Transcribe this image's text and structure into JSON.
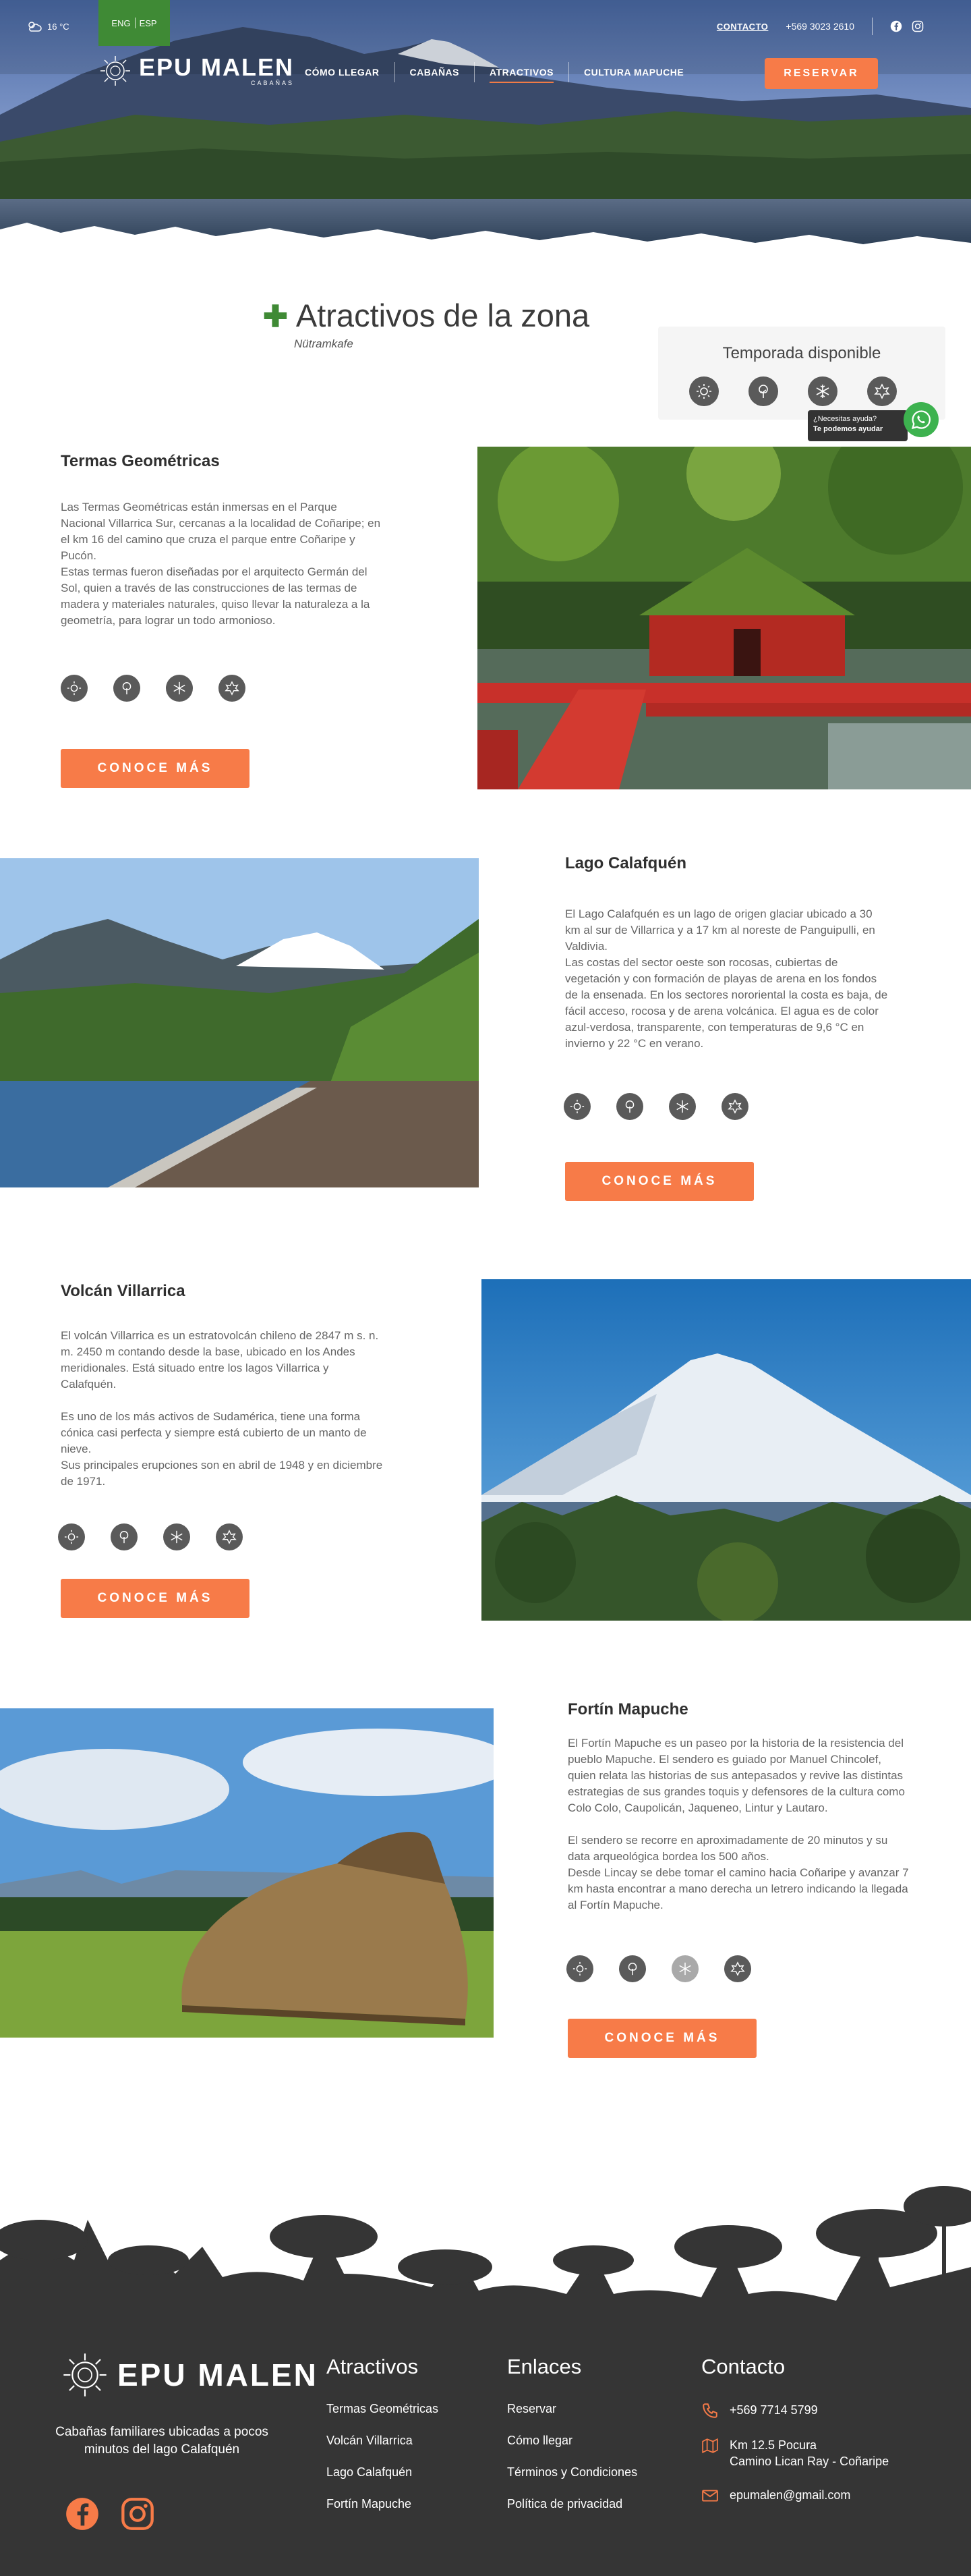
{
  "topbar": {
    "weather": "16 °C",
    "lang": [
      "ENG",
      "ESP"
    ],
    "contact_label": "CONTACTO",
    "phone": "+569 3023 2610"
  },
  "brand": {
    "name": "EPU MALEN",
    "sub": "CABAÑAS"
  },
  "nav": {
    "items": [
      "CÓMO LLEGAR",
      "CABAÑAS",
      "ATRACTIVOS",
      "CULTURA MAPUCHE"
    ],
    "active": "ATRACTIVOS",
    "reserve": "RESERVAR"
  },
  "page": {
    "title_highlight": "Atractivos",
    "title_rest": "de la zona",
    "subtitle": "Nütramkafe"
  },
  "season": {
    "label": "Temporada disponible",
    "icons": [
      "sun-icon",
      "spring-tree-icon",
      "snowflake-icon",
      "autumn-leaf-icon"
    ]
  },
  "help": {
    "line1": "¿Necesitas ayuda?",
    "line2": "Te podemos ayudar"
  },
  "attractions": [
    {
      "title": "Termas Geométricas",
      "paragraphs": [
        "Las Termas Geométricas están inmersas en el Parque Nacional Villarrica Sur, cercanas a la localidad de Coñaripe; en el km 16 del camino que cruza el parque entre Coñaripe y Pucón.",
        "Estas termas fueron diseñadas por el arquitecto Germán del Sol, quien a través de las construcciones de las termas de madera y materiales naturales, quiso llevar la naturaleza a la geometría, para lograr un todo armonioso."
      ],
      "button": "CONOCE MÁS"
    },
    {
      "title": "Lago Calafquén",
      "paragraphs": [
        "El Lago Calafquén es un lago de origen glaciar ubicado a 30 km al sur de Villarrica y a 17 km al noreste de Panguipulli, en Valdivia.",
        "Las costas del sector oeste son rocosas, cubiertas de vegetación y con formación de playas de arena en los fondos de la ensenada. En los sectores nororiental la costa es baja, de fácil acceso, rocosa y de arena volcánica. El agua es de color azul-verdosa, transparente, con temperaturas de 9,6 °C en invierno y 22 °C en verano."
      ],
      "button": "CONOCE MÁS"
    },
    {
      "title": "Volcán Villarrica",
      "paragraphs": [
        "El volcán Villarrica es un estratovolcán chileno de 2847 m s. n. m. 2450 m contando desde la base, ubicado en los Andes meridionales. Está situado entre los lagos Villarrica y Calafquén.",
        "Es uno de los más activos de Sudamérica, tiene una forma cónica casi perfecta y siempre está cubierto de un manto de nieve.",
        "Sus principales erupciones son en abril de 1948 y en diciembre de 1971."
      ],
      "button": "CONOCE MÁS"
    },
    {
      "title": "Fortín Mapuche",
      "paragraphs": [
        "El Fortín Mapuche es un paseo por la historia de la resistencia del pueblo Mapuche. El sendero es guiado por Manuel Chincolef, quien relata las historias de sus antepasados y revive las distintas estrategias de sus grandes toquis y defensores de la cultura como Colo Colo, Caupolicán, Jaqueneo, Lintur y Lautaro.",
        "El sendero se recorre en aproximadamente de 20 minutos y su data arqueológica bordea los 500 años.",
        "Desde Lincay se debe tomar el camino hacia Coñaripe y avanzar 7 km hasta encontrar a mano derecha un letrero indicando la llegada al Fortín Mapuche."
      ],
      "button": "CONOCE MÁS"
    }
  ],
  "footer": {
    "tagline": "Cabañas familiares ubicadas a pocos minutos del lago Calafquén",
    "col1": {
      "title": "Atractivos",
      "links": [
        "Termas Geométricas",
        "Volcán Villarrica",
        "Lago Calafquén",
        "Fortín Mapuche"
      ]
    },
    "col2": {
      "title": "Enlaces",
      "links": [
        "Reservar",
        "Cómo llegar",
        "Términos y Condiciones",
        "Política de privacidad"
      ]
    },
    "col3": {
      "title": "Contacto",
      "phone": "+569 7714 5799",
      "address1": "Km 12.5 Pocura",
      "address2": "Camino Lican Ray - Coñaripe",
      "email": "epumalen@gmail.com"
    }
  },
  "colors": {
    "accent": "#f77b48",
    "green": "#3f8a35",
    "footer": "#353535"
  }
}
